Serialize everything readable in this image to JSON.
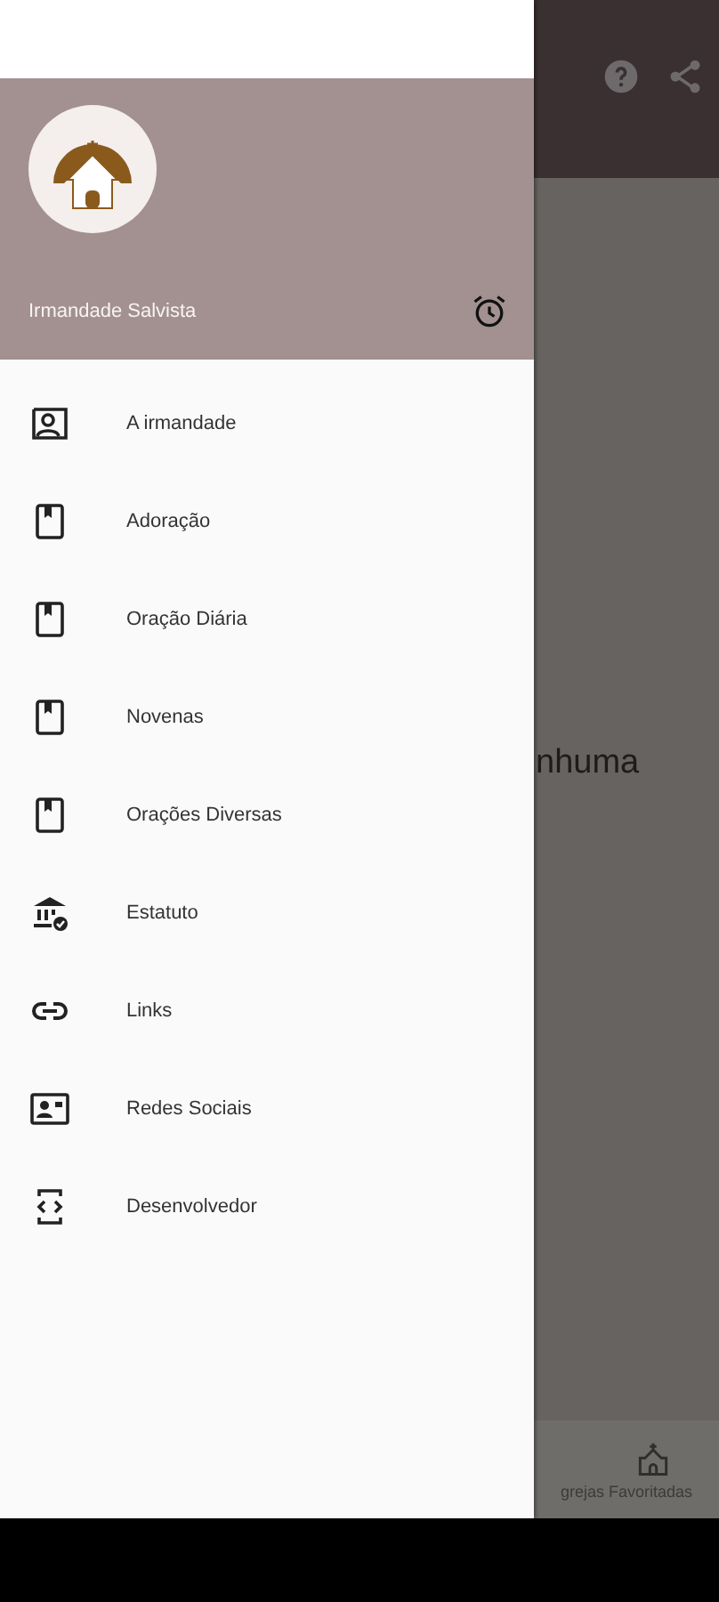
{
  "drawer": {
    "header": {
      "title": "Irmandade Salvista"
    },
    "items": [
      {
        "label": "A irmandade",
        "kind": "profile"
      },
      {
        "label": "Adoração",
        "kind": "book"
      },
      {
        "label": "Oração Diária",
        "kind": "book"
      },
      {
        "label": "Novenas",
        "kind": "book"
      },
      {
        "label": "Orações Diversas",
        "kind": "book"
      },
      {
        "label": "Estatuto",
        "kind": "bank"
      },
      {
        "label": "Links",
        "kind": "link"
      },
      {
        "label": "Redes Sociais",
        "kind": "contact"
      },
      {
        "label": "Desenvolvedor",
        "kind": "code"
      }
    ]
  },
  "content": {
    "message": "nhuma"
  },
  "bottom_nav": {
    "items": [
      {
        "label": "grejas Favoritadas"
      }
    ]
  }
}
